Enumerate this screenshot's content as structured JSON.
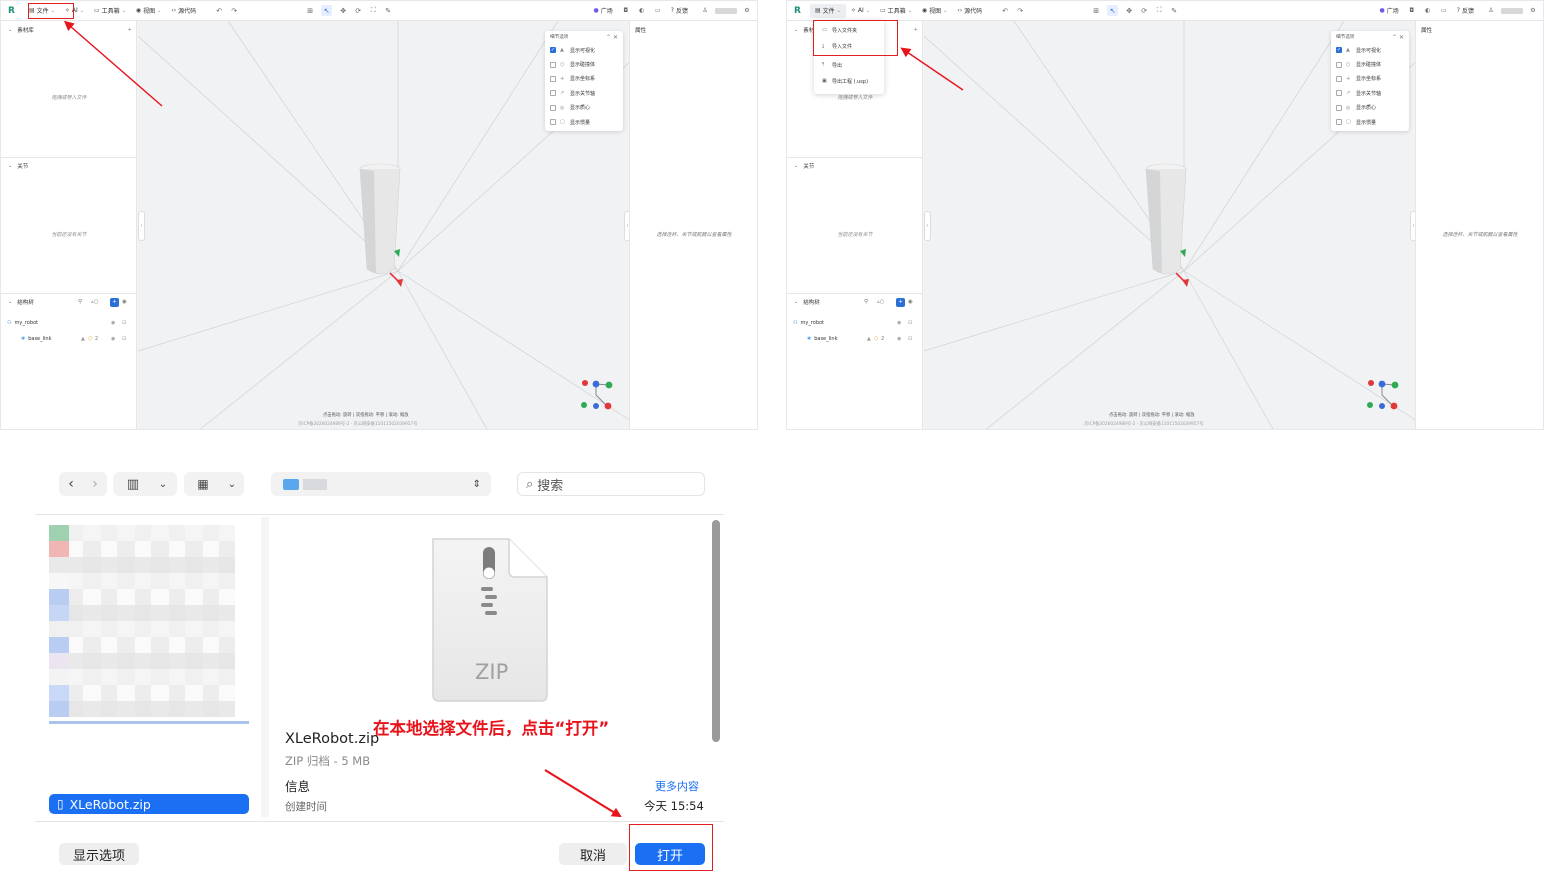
{
  "editor": {
    "logo": "R",
    "menus": [
      {
        "label": "文件",
        "icon": "file-icon"
      },
      {
        "label": "AI",
        "icon": "ai-icon"
      },
      {
        "label": "工具箱",
        "icon": "toolbox-icon"
      },
      {
        "label": "视图",
        "icon": "eye-icon"
      },
      {
        "label": "源代码",
        "icon": "code-icon"
      }
    ],
    "right_menus": [
      {
        "label": "广场"
      },
      {
        "label": "反馈"
      }
    ],
    "left_sections": {
      "assets_title": "素材库",
      "assets_empty": "拖拽或导入文件",
      "joints_title": "关节",
      "joints_empty": "当前还没有关节",
      "tree_title": "结构树",
      "tree_items": [
        {
          "label": "my_robot"
        },
        {
          "label": "base_link",
          "meta": "2"
        }
      ]
    },
    "right_panel": {
      "title": "属性",
      "empty": "选择连杆、关节或肌腱以查看属性"
    },
    "detail_panel": {
      "title": "细节选项",
      "options": [
        {
          "label": "显示可视化",
          "checked": true
        },
        {
          "label": "显示碰撞体",
          "checked": false
        },
        {
          "label": "显示坐标系",
          "checked": false
        },
        {
          "label": "显示关节轴",
          "checked": false
        },
        {
          "label": "显示质心",
          "checked": false
        },
        {
          "label": "显示惯量",
          "checked": false
        }
      ]
    },
    "hint": "点击拖动: 旋转 | 双指拖动: 平移 | 滚动: 缩放",
    "footer": "京ICP备2026024989号-2  ·  京公网安备11011502039957号",
    "file_menu_items": [
      {
        "label": "导入文件夹",
        "icon": "folder-icon"
      },
      {
        "label": "导入文件",
        "icon": "import-icon"
      },
      {
        "label": "导出",
        "icon": "export-icon"
      },
      {
        "label": "导出工程 (.usp)",
        "icon": "package-icon"
      }
    ]
  },
  "dialog": {
    "search_placeholder": "搜索",
    "selected_file": "XLeRobot.zip",
    "preview_icon_label": "ZIP",
    "file_name": "XLeRobot.zip",
    "file_kind": "ZIP 归档 - 5 MB",
    "info_heading": "信息",
    "more_link": "更多内容",
    "created_label": "创建时间",
    "created_value": "今天 15:54",
    "show_options_button": "显示选项",
    "cancel_button": "取消",
    "open_button": "打开",
    "accent_color": "#1a6ff2"
  },
  "annotation": {
    "text": "在本地选择文件后，点击“打开”",
    "color": "#e8141c"
  }
}
